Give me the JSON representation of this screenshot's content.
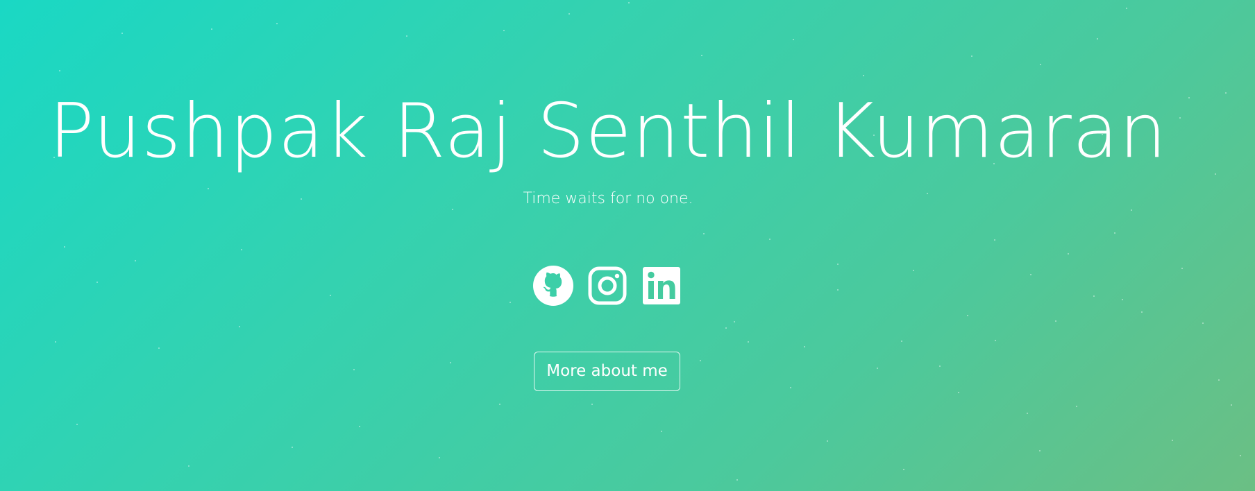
{
  "hero": {
    "name": "Pushpak Raj Senthil Kumaran",
    "tagline": "Time waits for no one.",
    "socials": [
      {
        "icon": "github-icon",
        "label": "GitHub"
      },
      {
        "icon": "instagram-icon",
        "label": "Instagram"
      },
      {
        "icon": "linkedin-icon",
        "label": "LinkedIn"
      }
    ],
    "cta_label": "More about me"
  },
  "colors": {
    "gradient_start": "#1ad8c4",
    "gradient_end": "#6bbf84",
    "text": "#ffffff"
  }
}
